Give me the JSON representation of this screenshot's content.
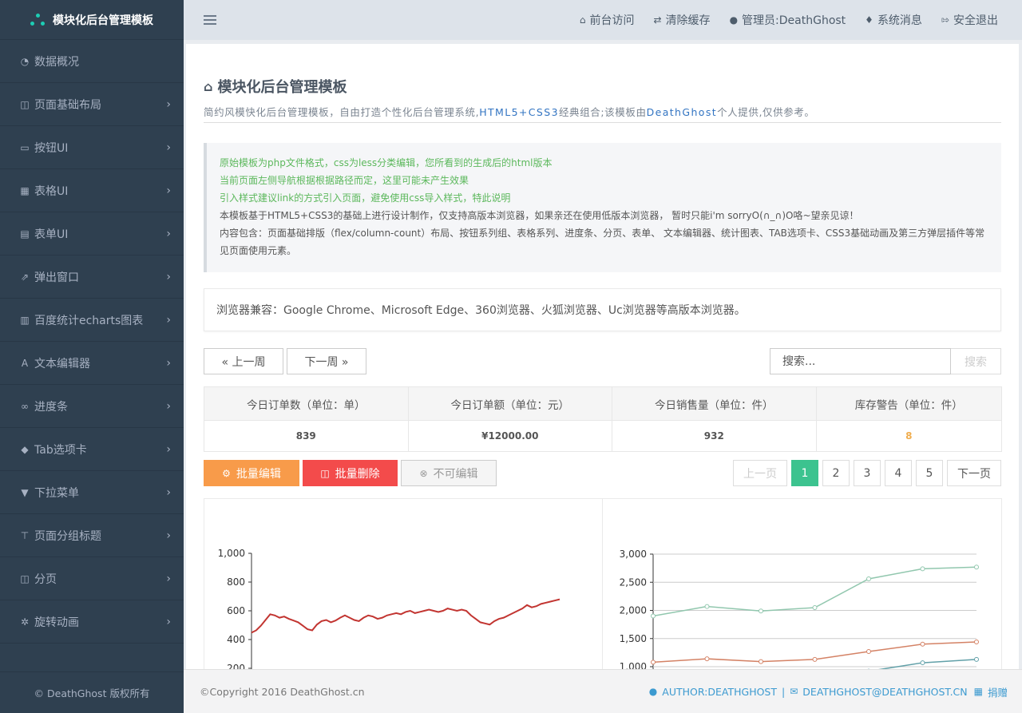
{
  "app": {
    "title": "模块化后台管理模板",
    "copyright": "© DeathGhost 版权所有"
  },
  "nav": [
    {
      "label": "数据概况",
      "icon": "dashboard-icon",
      "has_children": false
    },
    {
      "label": "页面基础布局",
      "icon": "columns-icon",
      "has_children": true
    },
    {
      "label": "按钮UI",
      "icon": "inbox-icon",
      "has_children": true
    },
    {
      "label": "表格UI",
      "icon": "table-icon",
      "has_children": true
    },
    {
      "label": "表单UI",
      "icon": "list-alt-icon",
      "has_children": true
    },
    {
      "label": "弹出窗口",
      "icon": "external-link-icon",
      "has_children": true
    },
    {
      "label": "百度统计echarts图表",
      "icon": "bar-chart-icon",
      "has_children": true
    },
    {
      "label": "文本编辑器",
      "icon": "font-icon",
      "has_children": true
    },
    {
      "label": "进度条",
      "icon": "binoculars-icon",
      "has_children": true
    },
    {
      "label": "Tab选项卡",
      "icon": "tags-icon",
      "has_children": true
    },
    {
      "label": "下拉菜单",
      "icon": "filter-icon",
      "has_children": true
    },
    {
      "label": "页面分组标题",
      "icon": "sitemap-icon",
      "has_children": true
    },
    {
      "label": "分页",
      "icon": "columns-icon",
      "has_children": true
    },
    {
      "label": "旋转动画",
      "icon": "spinner-icon",
      "has_children": true
    }
  ],
  "topbar": {
    "links": [
      {
        "label": "前台访问",
        "icon": "home-icon"
      },
      {
        "label": "清除缓存",
        "icon": "random-icon"
      },
      {
        "label": "管理员:DeathGhost",
        "icon": "user-icon"
      },
      {
        "label": "系统消息",
        "icon": "bell-icon"
      },
      {
        "label": "安全退出",
        "icon": "sign-out-icon"
      }
    ]
  },
  "page": {
    "title": "模块化后台管理模板",
    "desc_before": "简约风模快化后台管理模板，自由打造个性化后台管理系统,",
    "desc_tech": "HTML5+CSS3",
    "desc_mid": "经典组合;该模板由",
    "desc_author": "DeathGhost",
    "desc_after": "个人提供,仅供参考。"
  },
  "notice": {
    "line1": "原始模板为php文件格式，css为less分类编辑，您所看到的生成后的html版本",
    "line2": "当前页面左侧导航根据根据路径而定，这里可能未产生效果",
    "line3": "引入样式建议link的方式引入页面，避免使用css导入样式，特此说明",
    "line4": "本模板基于HTML5+CSS3的基础上进行设计制作，仅支持高版本浏览器，如果亲还在使用低版本浏览器， 暂时只能i'm sorryO(∩_∩)O咯~望亲见谅！",
    "line5": "内容包含：页面基础排版（flex/column-count）布局、按钮系列组、表格系列、进度条、分页、表单、 文本编辑器、统计图表、TAB选项卡、CSS3基础动画及第三方弹层插件等常见页面使用元素。"
  },
  "compat": "浏览器兼容：Google Chrome、Microsoft Edge、360浏览器、火狐浏览器、Uc浏览器等高版本浏览器。",
  "toolbar": {
    "prev_week": "« 上一周",
    "next_week": "下一周 »",
    "search_placeholder": "搜索...",
    "search_button": "搜索"
  },
  "stats": {
    "headers": [
      "今日订单数（单位：单）",
      "今日订单额（单位：元）",
      "今日销售量（单位：件）",
      "库存警告（单位：件）"
    ],
    "values": [
      "839",
      "¥12000.00",
      "932",
      "8"
    ]
  },
  "actions": {
    "batch_edit": "批量编辑",
    "batch_delete": "批量删除",
    "not_editable": "不可编辑"
  },
  "pagination": {
    "prev": "上一页",
    "pages": [
      "1",
      "2",
      "3",
      "4",
      "5"
    ],
    "active": "1",
    "next": "下一页"
  },
  "chart_data": [
    {
      "type": "line",
      "ylim": [
        0,
        1000
      ],
      "y_ticks": [
        "1,000",
        "800",
        "600",
        "400",
        "200"
      ],
      "color": "#c23531",
      "series": [
        {
          "values": [
            310,
            330,
            370,
            420,
            470,
            460,
            440,
            450,
            430,
            415,
            400,
            370,
            340,
            330,
            380,
            410,
            420,
            400,
            415,
            440,
            460,
            440,
            420,
            410,
            440,
            460,
            450,
            430,
            440,
            460,
            470,
            480,
            470,
            490,
            500,
            480,
            490,
            500,
            510,
            500,
            490,
            500,
            520,
            510,
            500,
            510,
            500,
            460,
            430,
            400,
            390,
            380,
            410,
            430,
            440,
            460,
            480,
            500,
            520,
            550,
            530,
            540,
            560,
            570,
            580,
            590,
            600
          ]
        }
      ]
    },
    {
      "type": "line",
      "ylim": [
        1000,
        3000
      ],
      "y_ticks": [
        "3,000",
        "2,500",
        "2,000",
        "1,500",
        "1,000"
      ],
      "series": [
        {
          "color": "#91c7ae",
          "values": [
            1900,
            2070,
            1990,
            2050,
            2560,
            2740,
            2770
          ]
        },
        {
          "color": "#d48265",
          "values": [
            1080,
            1140,
            1090,
            1130,
            1270,
            1400,
            1440
          ]
        },
        {
          "color": "#61a0a8",
          "values": [
            600,
            650,
            700,
            800,
            920,
            1070,
            1130
          ]
        }
      ]
    }
  ],
  "footer": {
    "left": "©Copyright 2016 DeathGhost.cn",
    "author": "AUTHOR:DEATHGHOST",
    "sep": "|",
    "email": "DEATHGHOST@DEATHGHOST.CN",
    "donate": "捐赠"
  }
}
